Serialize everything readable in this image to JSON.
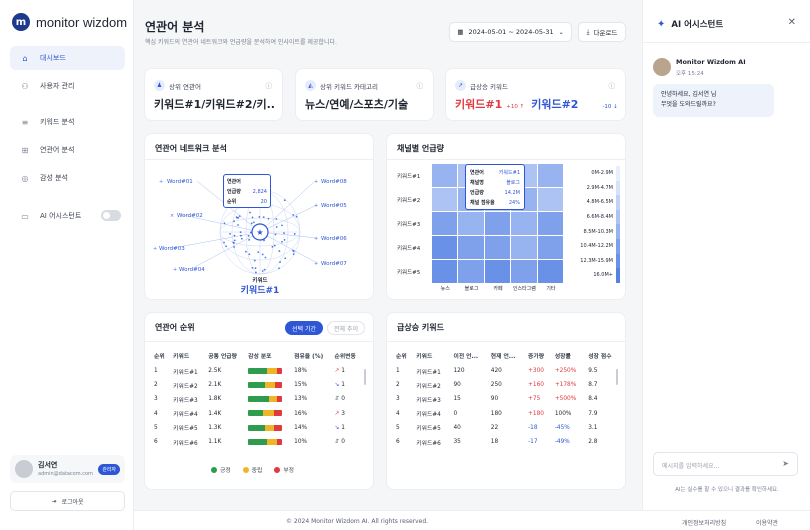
{
  "brand": {
    "name": "monitor wizdom",
    "logo_letter": "m"
  },
  "sidebar": {
    "items": [
      {
        "label": "대시보드",
        "icon": "home-icon"
      },
      {
        "label": "사용자 관리",
        "icon": "users-icon"
      },
      {
        "label": "키워드 분석",
        "icon": "keyword-icon"
      },
      {
        "label": "연관어 분석",
        "icon": "network-icon"
      },
      {
        "label": "감성 분석",
        "icon": "sentiment-icon"
      },
      {
        "label": "AI 어시스턴트",
        "icon": "chat-icon"
      }
    ],
    "ai_toggle": "off",
    "user": {
      "name": "김서연",
      "email": "admin@datacom.com",
      "role": "관리자"
    },
    "logout_label": "로그아웃"
  },
  "header": {
    "title": "연관어 분석",
    "subtitle": "핵심 키워드의 연관어 네트워크와 언급량을 분석하여 인사이트를 제공합니다.",
    "date_range": "2024-05-01 ~ 2024-05-31",
    "download_label": "다운로드"
  },
  "stats": [
    {
      "label": "상위 연관어",
      "value": "키워드#1/키워드#2/키..."
    },
    {
      "label": "상위 키워드 카테고리",
      "value": "뉴스/연예/스포츠/기술"
    },
    {
      "label": "급상승 키워드",
      "kw1": "키워드#1",
      "kw1_delta": "+10",
      "kw2": "키워드#2",
      "kw2_delta": "-10"
    }
  ],
  "network": {
    "title": "연관어 네트워크 분석",
    "nodes": [
      "Word#01",
      "Word#02",
      "Word#03",
      "Word#04",
      "Word#05",
      "Word#06",
      "Word#07",
      "Word#08"
    ],
    "tooltip": {
      "r1_label": "연관어",
      "r1_val": "",
      "r2_label": "언급량",
      "r2_val": "2,824",
      "r3_label": "순위",
      "r3_val": "20"
    },
    "center_label": "키워드",
    "center_value": "키워드#1"
  },
  "heatmap": {
    "title": "채널별 언급량",
    "rows": [
      "키워드#1",
      "키워드#2",
      "키워드#3",
      "키워드#4",
      "키워드#5"
    ],
    "cols": [
      "뉴스",
      "블로그",
      "카페",
      "인스타그램",
      "기타"
    ],
    "levels": [
      [
        2,
        1,
        2,
        1,
        2
      ],
      [
        1,
        2,
        1,
        2,
        1
      ],
      [
        3,
        2,
        3,
        2,
        3
      ],
      [
        4,
        3,
        3,
        2,
        3
      ],
      [
        4,
        3,
        4,
        3,
        4
      ]
    ],
    "legend": [
      "0M-2.9M",
      "2.9M-4.7M",
      "4.8M-6.5M",
      "6.6M-8.4M",
      "8.5M-10.3M",
      "10.4M-12.2M",
      "12.3M-15.9M",
      "16.0M+"
    ],
    "legend_colors": [
      "#e8eefc",
      "#d6e1fa",
      "#c2d2f7",
      "#adc3f4",
      "#97b3f0",
      "#7fa1ec",
      "#6a91e8",
      "#5482e4"
    ],
    "tooltip": {
      "rows": [
        {
          "k": "연관어",
          "v": "키워드#1"
        },
        {
          "k": "채널명",
          "v": "블로그"
        },
        {
          "k": "언급량",
          "v": "14.2M"
        },
        {
          "k": "채널 점유율",
          "v": "24%"
        }
      ]
    }
  },
  "ranking": {
    "title": "연관어 순위",
    "tab_active": "선택 기간",
    "tab_inactive": "전체 추이",
    "headers": [
      "순위",
      "키워드",
      "공통 언급량",
      "감성 분포",
      "점유율 (%)",
      "순위변동"
    ],
    "rows": [
      {
        "rank": "1",
        "kw": "키워드#1",
        "vol": "2.5K",
        "pos": 0.55,
        "neu": 0.3,
        "neg": 0.15,
        "share": "18%",
        "trend": "↗",
        "chg": "1"
      },
      {
        "rank": "2",
        "kw": "키워드#2",
        "vol": "2.1K",
        "pos": 0.5,
        "neu": 0.3,
        "neg": 0.2,
        "share": "15%",
        "trend": "↘",
        "chg": "1"
      },
      {
        "rank": "3",
        "kw": "키워드#3",
        "vol": "1.8K",
        "pos": 0.6,
        "neu": 0.25,
        "neg": 0.15,
        "share": "13%",
        "trend": "⇵",
        "chg": "0"
      },
      {
        "rank": "4",
        "kw": "키워드#4",
        "vol": "1.4K",
        "pos": 0.45,
        "neu": 0.3,
        "neg": 0.25,
        "share": "16%",
        "trend": "↗",
        "chg": "3"
      },
      {
        "rank": "5",
        "kw": "키워드#5",
        "vol": "1.3K",
        "pos": 0.5,
        "neu": 0.25,
        "neg": 0.25,
        "share": "14%",
        "trend": "↘",
        "chg": "1"
      },
      {
        "rank": "6",
        "kw": "키워드#6",
        "vol": "1.1K",
        "pos": 0.55,
        "neu": 0.3,
        "neg": 0.15,
        "share": "10%",
        "trend": "⇵",
        "chg": "0"
      }
    ],
    "legend": [
      "긍정",
      "중립",
      "부정"
    ],
    "colors": {
      "pos": "#2e9b4f",
      "neu": "#f0b429",
      "neg": "#e0393e"
    }
  },
  "rising": {
    "title": "급상승 키워드",
    "headers": [
      "순위",
      "키워드",
      "이전 언...",
      "현재 언...",
      "증가량",
      "성장률",
      "성장 점수"
    ],
    "rows": [
      {
        "rank": "1",
        "kw": "키워드#1",
        "prev": "120",
        "cur": "420",
        "inc": "+300",
        "rate": "+250%",
        "score": "9.5",
        "inc_c": "red",
        "rate_c": "red"
      },
      {
        "rank": "2",
        "kw": "키워드#2",
        "prev": "90",
        "cur": "250",
        "inc": "+160",
        "rate": "+178%",
        "score": "8.7",
        "inc_c": "red",
        "rate_c": "red"
      },
      {
        "rank": "3",
        "kw": "키워드#3",
        "prev": "15",
        "cur": "90",
        "inc": "+75",
        "rate": "+500%",
        "score": "8.4",
        "inc_c": "red",
        "rate_c": "red"
      },
      {
        "rank": "4",
        "kw": "키워드#4",
        "prev": "0",
        "cur": "180",
        "inc": "+180",
        "rate": "100%",
        "score": "7.9",
        "inc_c": "red",
        "rate_c": "dark"
      },
      {
        "rank": "5",
        "kw": "키워드#5",
        "prev": "40",
        "cur": "22",
        "inc": "-18",
        "rate": "-45%",
        "score": "3.1",
        "inc_c": "blue",
        "rate_c": "blue"
      },
      {
        "rank": "6",
        "kw": "키워드#6",
        "prev": "35",
        "cur": "18",
        "inc": "-17",
        "rate": "-49%",
        "score": "2.8",
        "inc_c": "blue",
        "rate_c": "blue"
      }
    ]
  },
  "assistant": {
    "title": "AI 어시스턴트",
    "bot_name": "Monitor Wizdom AI",
    "bot_time": "오후 15:24",
    "msg_line1": "안녕하세요,  김서연 님",
    "msg_line2": "무엇을 도와드릴까요?",
    "input_placeholder": "메시지를 입력하세요...",
    "disclaimer": "AI는 실수를 할 수 있으니 결과를 확인하세요."
  },
  "footer": {
    "copyright": "© 2024 Monitor Wizdom AI. All rights reserved.",
    "privacy": "개인정보처리방침",
    "terms": "이용약관"
  },
  "colors": {
    "accent": "#2f56d6",
    "red": "#e0393e",
    "blue": "#2f56d6"
  }
}
